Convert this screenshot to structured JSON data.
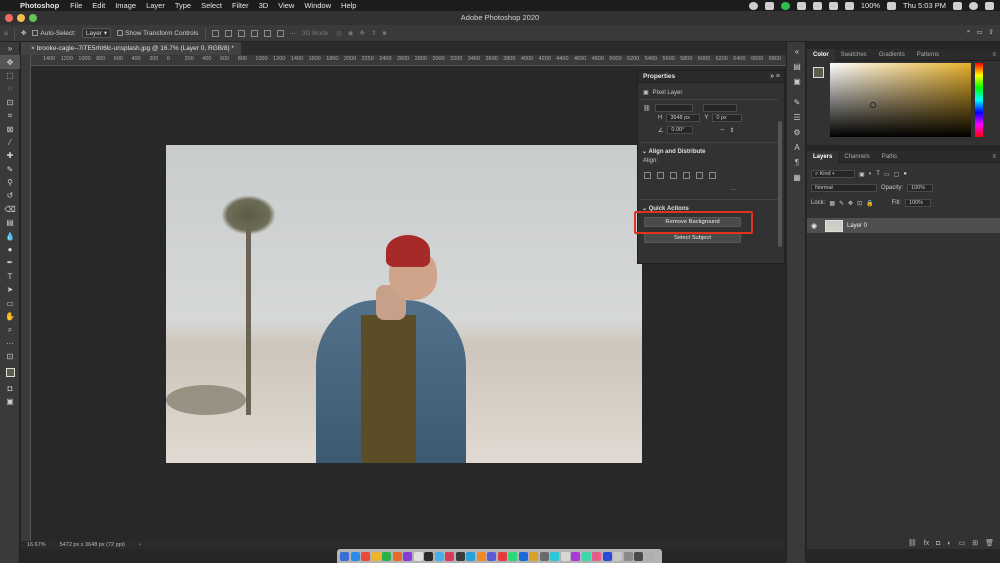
{
  "menubar": {
    "app_name": "Photoshop",
    "items": [
      "File",
      "Edit",
      "Image",
      "Layer",
      "Type",
      "Select",
      "Filter",
      "3D",
      "View",
      "Window",
      "Help"
    ],
    "battery": "100%",
    "clock": "Thu 5:03 PM"
  },
  "window": {
    "title": "Adobe Photoshop 2020"
  },
  "options_bar": {
    "auto_select_label": "Auto-Select:",
    "auto_select_value": "Layer",
    "transform_label": "Show Transform Controls",
    "mode_3d": "3D Mode:"
  },
  "document": {
    "tab_label": "brooke-cagle--7iTE5rhI6lc-unsplash.jpg @ 16.7% (Layer 0, RGB/8) *",
    "ruler_ticks": [
      "1400",
      "1200",
      "1000",
      "800",
      "600",
      "400",
      "200",
      "0",
      "200",
      "400",
      "600",
      "800",
      "1000",
      "1200",
      "1400",
      "1600",
      "1800",
      "2000",
      "2250",
      "2400",
      "2600",
      "2800",
      "3000",
      "3200",
      "3400",
      "3600",
      "3800",
      "4000",
      "4200",
      "4400",
      "4600",
      "4800",
      "5000",
      "5200",
      "5400",
      "5600",
      "5800",
      "6000",
      "6200",
      "6400",
      "6600",
      "6800"
    ]
  },
  "properties": {
    "title": "Properties",
    "layer_type": "Pixel Layer",
    "h_label": "H",
    "h_value": "3648 px",
    "y_label": "Y",
    "y_value": "0 px",
    "angle_value": "0.00°",
    "align_section": "Align and Distribute",
    "align_label": "Align:",
    "quick_actions": "Quick Actions",
    "remove_bg": "Remove Background",
    "select_subject": "Select Subject"
  },
  "color_panel": {
    "tabs": [
      "Color",
      "Swatches",
      "Gradients",
      "Patterns"
    ],
    "fg_color": "#5f5b49",
    "bg_color": "#ffffff"
  },
  "layers_panel": {
    "tabs": [
      "Layers",
      "Channels",
      "Paths"
    ],
    "kind": "Kind",
    "blend_mode": "Normal",
    "opacity_label": "Opacity:",
    "opacity_value": "100%",
    "lock_label": "Lock:",
    "fill_label": "Fill:",
    "fill_value": "100%",
    "layer_name": "Layer 0"
  },
  "status": {
    "zoom": "16.67%",
    "doc_size": "5472 px x 3648 px (72 ppi)"
  },
  "accent_colors": {
    "highlight": "#e0321c"
  }
}
